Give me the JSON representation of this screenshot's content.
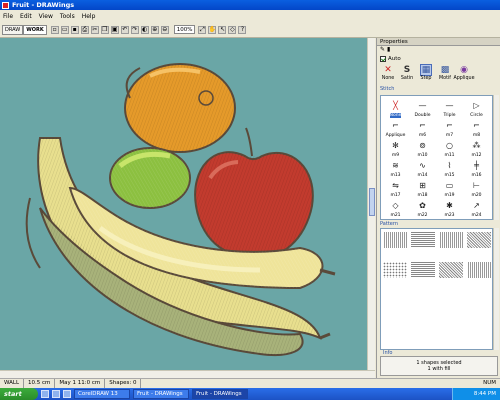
{
  "window": {
    "title": "Fruit - DRAWings"
  },
  "menu": [
    "File",
    "Edit",
    "View",
    "Tools",
    "Help"
  ],
  "toolbar": {
    "tabs": [
      "DRAW",
      "WORK"
    ],
    "zoom": "100%"
  },
  "panel": {
    "title": "Properties",
    "auto_label": "Auto",
    "modes": [
      {
        "label": "None",
        "icon": "✕",
        "color": "#cc2222"
      },
      {
        "label": "Satin",
        "icon": "S",
        "color": "#333333"
      },
      {
        "label": "Step",
        "icon": "▦",
        "color": "#3a5aa0"
      },
      {
        "label": "Motif",
        "icon": "▩",
        "color": "#3a5aa0"
      },
      {
        "label": "Applique",
        "icon": "◉",
        "color": "#7a3aa0"
      }
    ],
    "stitch_section": "Stitch",
    "stitches": [
      {
        "label": "None",
        "glyph": "╳",
        "selected": true
      },
      {
        "label": "Double",
        "glyph": "—"
      },
      {
        "label": "Triple",
        "glyph": "—"
      },
      {
        "label": "Circle",
        "glyph": "▷"
      },
      {
        "label": "Applique",
        "glyph": "⌐"
      },
      {
        "label": "m6",
        "glyph": "⌐"
      },
      {
        "label": "m7",
        "glyph": "⌐"
      },
      {
        "label": "m8",
        "glyph": "⌐"
      },
      {
        "label": "m9",
        "glyph": "✻"
      },
      {
        "label": "m10",
        "glyph": "⊚"
      },
      {
        "label": "m11",
        "glyph": "○"
      },
      {
        "label": "m12",
        "glyph": "⁂"
      },
      {
        "label": "m13",
        "glyph": "≋"
      },
      {
        "label": "m14",
        "glyph": "∿"
      },
      {
        "label": "m15",
        "glyph": "⌇"
      },
      {
        "label": "m16",
        "glyph": "╪"
      },
      {
        "label": "m17",
        "glyph": "⇋"
      },
      {
        "label": "m18",
        "glyph": "⊞"
      },
      {
        "label": "m19",
        "glyph": "▭"
      },
      {
        "label": "m20",
        "glyph": "⊢"
      },
      {
        "label": "m21",
        "glyph": "◇"
      },
      {
        "label": "m22",
        "glyph": "✿"
      },
      {
        "label": "m23",
        "glyph": "✱"
      },
      {
        "label": "m24",
        "glyph": "↗"
      }
    ],
    "pattern_section": "Pattern",
    "patterns": [
      {
        "label": "",
        "style": ""
      },
      {
        "label": "",
        "style": "c"
      },
      {
        "label": "",
        "style": ""
      },
      {
        "label": "",
        "style": "b"
      },
      {
        "label": "",
        "style": "d"
      },
      {
        "label": "",
        "style": "c"
      },
      {
        "label": "",
        "style": "b"
      },
      {
        "label": "",
        "style": ""
      }
    ],
    "info_section": "Info",
    "info_text_1": "1 shapes selected",
    "info_text_2": "1 with fill"
  },
  "status": {
    "fields": [
      "WALL",
      "10.5 cm",
      "May 1 11:0 cm",
      "Shapes: 0"
    ],
    "right": "NUM"
  },
  "taskbar": {
    "start": "start",
    "items": [
      "CorelDRAW 13",
      "Fruit - DRAWings",
      "Fruit - DRAWings"
    ],
    "time": "8:44 PM"
  },
  "colors": {
    "canvas": "#6aa6a6",
    "orange": "#e59a2a",
    "lime": "#8cc040",
    "apple": "#c23b2e",
    "banana": "#e8df8e",
    "banana_shadow": "#a8b27a",
    "outline": "#5a4a3a"
  }
}
